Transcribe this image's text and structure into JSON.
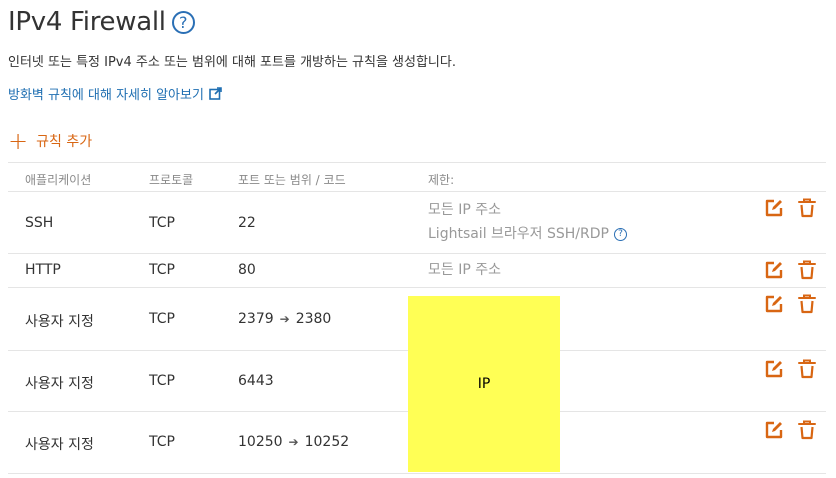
{
  "header": {
    "title": "IPv4 Firewall",
    "help_icon_text": "?",
    "description": "인터넷 또는 특정 IPv4 주소 또는 범위에 대해 포트를 개방하는 규칙을 생성합니다.",
    "learn_more_link": "방화벽 규칙에 대해 자세히 알아보기"
  },
  "add_rule": {
    "icon": "+",
    "label": "규칙 추가"
  },
  "table": {
    "columns": {
      "application": "애플리케이션",
      "protocol": "프로토콜",
      "port": "포트 또는 범위 / 코드",
      "restrict": "제한:"
    },
    "rows": [
      {
        "application": "SSH",
        "protocol": "TCP",
        "port_start": "22",
        "restrict_line1": "모든 IP 주소",
        "restrict_line2": "Lightsail 브라우저 SSH/RDP"
      },
      {
        "application": "HTTP",
        "protocol": "TCP",
        "port_start": "80",
        "restrict_line1": "모든 IP 주소"
      },
      {
        "application": "사용자 지정",
        "protocol": "TCP",
        "port_start": "2379",
        "port_end": "2380"
      },
      {
        "application": "사용자 지정",
        "protocol": "TCP",
        "port_start": "6443"
      },
      {
        "application": "사용자 지정",
        "protocol": "TCP",
        "port_start": "10250",
        "port_end": "10252"
      }
    ]
  },
  "redacted_overlay": {
    "label": "IP"
  },
  "colors": {
    "accent_orange": "#d86613",
    "link_blue": "#1f6fb2",
    "redaction_yellow": "#ffff55"
  },
  "icons": {
    "edit": "edit-icon",
    "delete": "trash-icon",
    "help": "help-circle-icon",
    "external": "external-link-icon"
  }
}
